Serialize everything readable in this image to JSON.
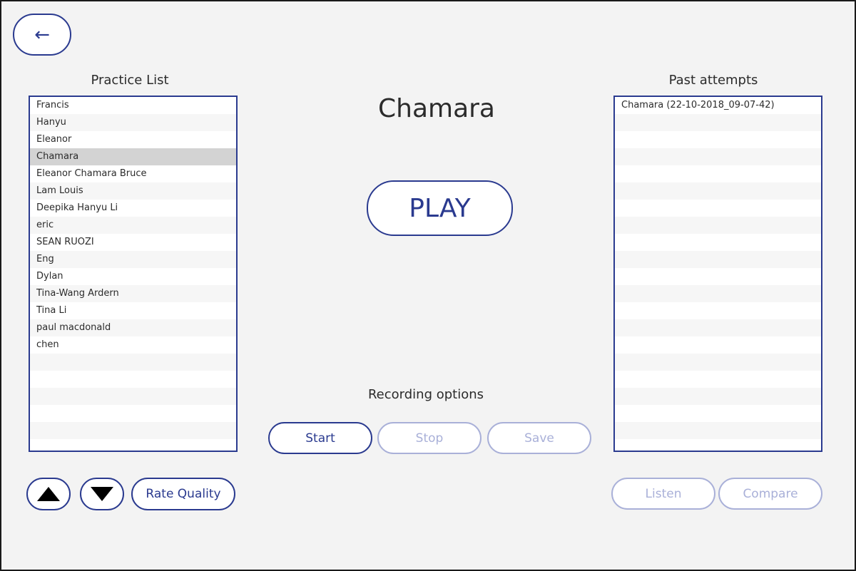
{
  "back_button": {
    "label": "←"
  },
  "practice_list": {
    "title": "Practice List",
    "items": [
      "Francis",
      "Hanyu",
      "Eleanor",
      "Chamara",
      "Eleanor Chamara Bruce",
      "Lam Louis",
      "Deepika Hanyu Li",
      "eric",
      "SEAN RUOZI",
      "Eng",
      "Dylan",
      "Tina-Wang Ardern",
      "Tina Li",
      "paul macdonald",
      "chen",
      "",
      "",
      "",
      "",
      "",
      ""
    ],
    "selected_index": 3
  },
  "current_name": "Chamara",
  "play_button": {
    "label": "PLAY"
  },
  "recording": {
    "title": "Recording options",
    "start_label": "Start",
    "stop_label": "Stop",
    "save_label": "Save"
  },
  "past_attempts": {
    "title": "Past attempts",
    "items": [
      "Chamara (22-10-2018_09-07-42)",
      "",
      "",
      "",
      "",
      "",
      "",
      "",
      "",
      "",
      "",
      "",
      "",
      "",
      "",
      "",
      "",
      "",
      "",
      "",
      ""
    ]
  },
  "bottom_left": {
    "up_icon": "triangle-up-icon",
    "down_icon": "triangle-down-icon",
    "rate_label": "Rate Quality"
  },
  "bottom_right": {
    "listen_label": "Listen",
    "compare_label": "Compare"
  },
  "colors": {
    "accent": "#2a3a8f",
    "disabled": "#a9b0d8",
    "background": "#f3f3f3",
    "selected_row": "#d3d3d3"
  }
}
